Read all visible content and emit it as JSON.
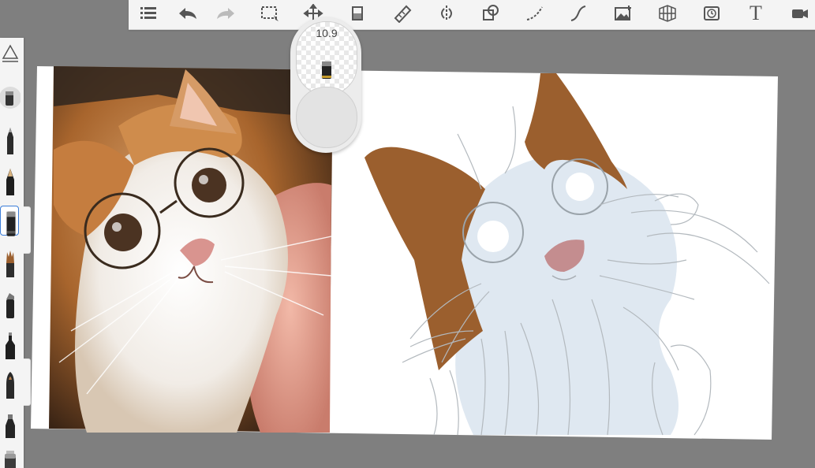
{
  "app": {
    "brush_size_value": "10.9",
    "text_tool_label": "T"
  },
  "toolbar": {
    "tools": [
      "list-icon",
      "undo-icon",
      "redo-icon",
      "selection-icon",
      "transform-icon",
      "fill-icon",
      "ruler-icon",
      "symmetry-icon",
      "shapes-icon",
      "stroke-icon",
      "curve-icon",
      "image-icon",
      "perspective-icon",
      "time-lapse-icon",
      "text-icon",
      "video-icon"
    ]
  },
  "brushes": [
    "eraser-brush-icon",
    "pencil-brush-icon",
    "colored-pencil-brush-icon",
    "marker-brush-icon",
    "paint-brush-icon",
    "chisel-marker-brush-icon",
    "ink-pen-brush-icon",
    "fountain-pen-brush-icon",
    "airbrush-brush-icon",
    "blender-brush-icon"
  ],
  "colors": {
    "background": "#7f7f7f",
    "toolbar": "#f4f4f4",
    "icon": "#555555",
    "selection_accent": "#3b7dd8",
    "fur_brown": "#9b5f2e",
    "fur_light_blue": "#dfe8f1",
    "nose_pink": "#c48d8f",
    "photo_orange": "#c9864a"
  }
}
